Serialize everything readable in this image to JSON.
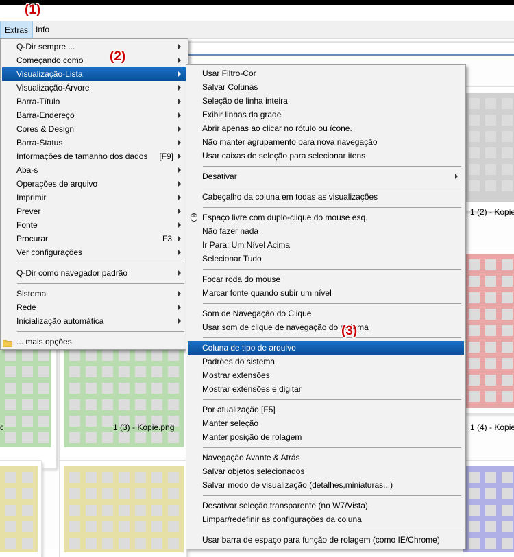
{
  "menubar": {
    "items": [
      {
        "label": "Extras",
        "active": true
      },
      {
        "label": "Info",
        "active": false
      }
    ]
  },
  "annotations": [
    "(1)",
    "(2)",
    "(3)"
  ],
  "captions": [
    "1 (2) - Kopie",
    "1 (3) - Kopie.png",
    "1 (4) - Kopie"
  ],
  "left_menu": {
    "items": [
      {
        "label": "Q-Dir sempre ...",
        "arrow": true
      },
      {
        "label": "Começando como",
        "arrow": true
      },
      {
        "label": "Visualização-Lista",
        "arrow": true,
        "highlighted": true
      },
      {
        "label": "Visualização-Árvore",
        "arrow": true
      },
      {
        "label": "Barra-Título",
        "arrow": true
      },
      {
        "label": "Barra-Endereço",
        "arrow": true
      },
      {
        "label": "Cores & Design",
        "arrow": true
      },
      {
        "label": "Barra-Status",
        "arrow": true
      },
      {
        "label": "Informações de tamanho dos dados",
        "shortcut": "[F9]",
        "arrow": true
      },
      {
        "label": "Aba-s",
        "arrow": true
      },
      {
        "label": "Operações de arquivo",
        "arrow": true
      },
      {
        "label": "Imprimir",
        "arrow": true
      },
      {
        "label": "Prever",
        "arrow": true
      },
      {
        "label": "Fonte",
        "arrow": true
      },
      {
        "label": "Procurar",
        "shortcut": "F3",
        "arrow": true
      },
      {
        "label": "Ver configurações",
        "arrow": true
      },
      {
        "label": "Q-Dir como navegador padrão",
        "arrow": true
      },
      {
        "label": "Sistema",
        "arrow": true
      },
      {
        "label": "Rede",
        "arrow": true
      },
      {
        "label": "Inicialização automática",
        "arrow": true
      },
      {
        "label": "... mais opções",
        "icon": "folder-icon"
      }
    ]
  },
  "right_menu": {
    "items": [
      {
        "label": "Usar Filtro-Cor"
      },
      {
        "label": "Salvar Colunas"
      },
      {
        "label": "Seleção de linha inteira"
      },
      {
        "label": "Exibir linhas da grade"
      },
      {
        "label": "Abrir apenas ao clicar no rótulo ou ícone."
      },
      {
        "label": "Não manter agrupamento para nova navegação"
      },
      {
        "label": "Usar caixas de seleção para selecionar itens"
      },
      {
        "label": "Desativar",
        "arrow": true
      },
      {
        "label": "Cabeçalho da coluna em todas as visualizações"
      },
      {
        "label": "Espaço livre com duplo-clique do mouse esq.",
        "icon": "mouse-icon"
      },
      {
        "label": "Não fazer nada"
      },
      {
        "label": "Ir Para: Um Nível Acima"
      },
      {
        "label": "Selecionar Tudo"
      },
      {
        "label": "Focar roda do mouse"
      },
      {
        "label": "Marcar fonte quando subir um nível"
      },
      {
        "label": "Som de Navegação do Clique"
      },
      {
        "label": "Usar som de clique de navegação do sistema"
      },
      {
        "label": "Coluna de tipo de arquivo",
        "highlighted": true
      },
      {
        "label": "Padrões do sistema"
      },
      {
        "label": "Mostrar extensões"
      },
      {
        "label": "Mostrar extensões e digitar"
      },
      {
        "label": "Por atualização [F5]"
      },
      {
        "label": "Manter seleção"
      },
      {
        "label": "Manter posição de rolagem"
      },
      {
        "label": "Navegação Avante & Atrás"
      },
      {
        "label": "Salvar objetos selecionados"
      },
      {
        "label": "Salvar modo de visualização (detalhes,miniaturas...)"
      },
      {
        "label": "Desativar seleção transparente (no W7/Vista)"
      },
      {
        "label": "Limpar/redefinir as configurações da coluna"
      },
      {
        "label": "Usar barra de espaço para função de rolagem (como IE/Chrome)"
      }
    ]
  },
  "colors": {
    "highlight": "#0a4f9c",
    "annotation": "#cc0000",
    "menu_bg": "#f2f2f2"
  }
}
